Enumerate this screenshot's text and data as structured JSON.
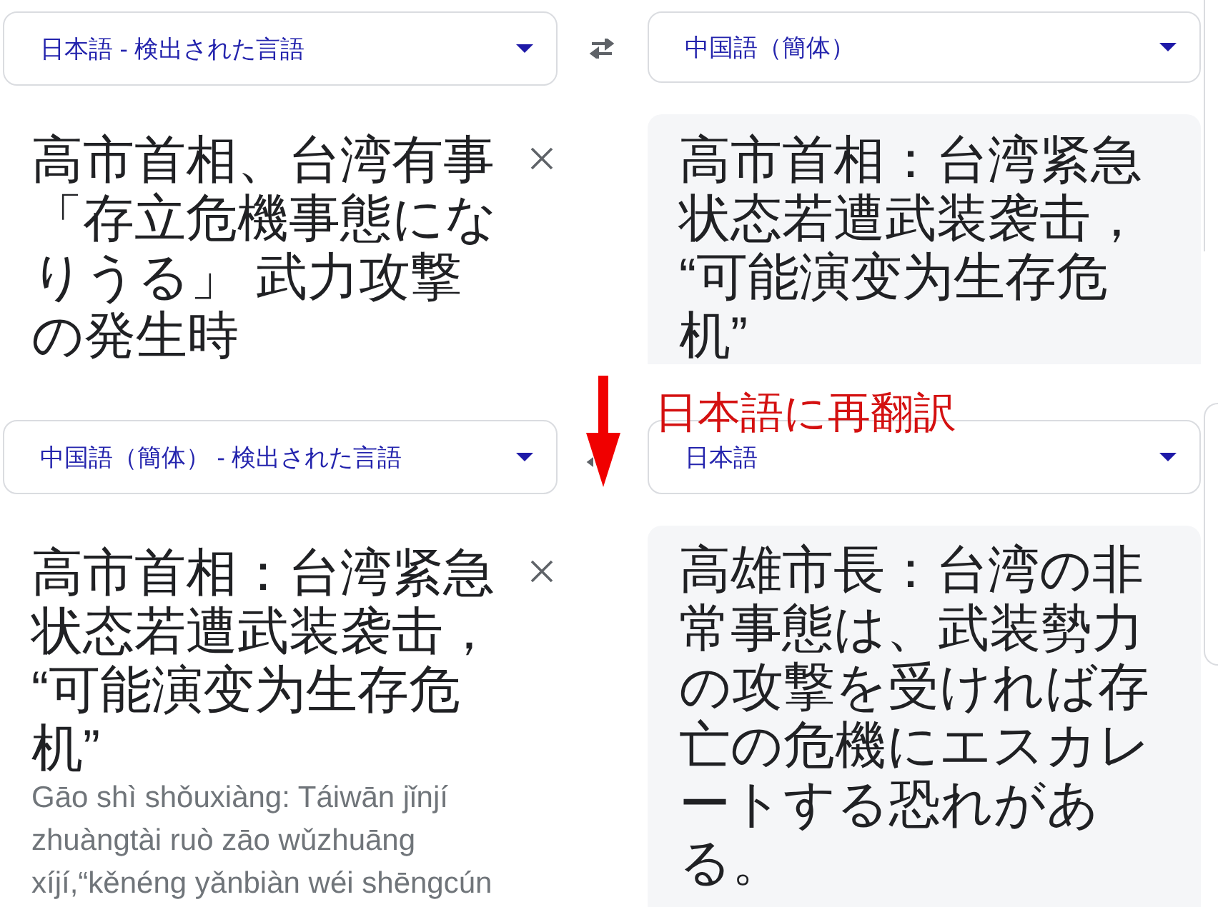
{
  "panels": [
    {
      "source_language": {
        "label": "日本語 - 検出された言語"
      },
      "target_language": {
        "label": "中国語（簡体）"
      },
      "source_text": "高市首相、台湾有事「存立危機事態になりうる」 武力攻撃の発生時",
      "translation": "高市首相：台湾紧急状态若遭武装袭击，“可能演变为生存危机”"
    },
    {
      "source_language": {
        "label": "中国語（簡体） - 検出された言語"
      },
      "target_language": {
        "label": "日本語"
      },
      "source_text": "高市首相：台湾紧急状态若遭武装袭击，“可能演变为生存危机”",
      "source_romanization": "Gāo shì shǒuxiàng: Táiwān jǐnjí zhuàngtài ruò zāo wǔzhuāng xíjí,“kěnéng yǎnbiàn wéi shēngcún",
      "translation": "高雄市長：台湾の非常事態は、武装勢力の攻撃を受ければ存亡の危機にエスカレートする恐れがある。"
    }
  ],
  "annotation": {
    "text": "日本語に再翻訳"
  }
}
